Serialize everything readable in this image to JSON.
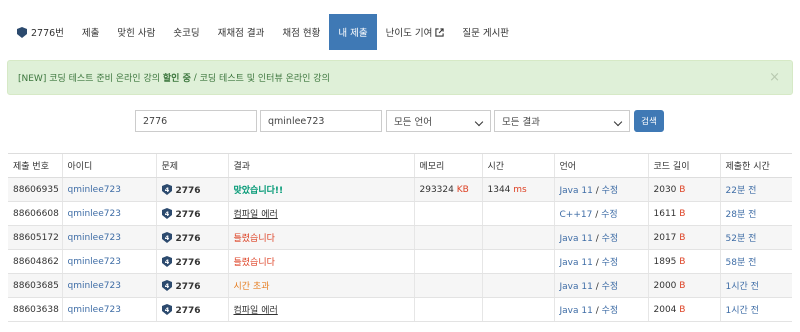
{
  "nav": {
    "items": [
      {
        "label": "2776번",
        "active": false
      },
      {
        "label": "제출",
        "active": false
      },
      {
        "label": "맞힌 사람",
        "active": false
      },
      {
        "label": "숏코딩",
        "active": false
      },
      {
        "label": "재채점 결과",
        "active": false
      },
      {
        "label": "채점 현황",
        "active": false
      },
      {
        "label": "내 제출",
        "active": true
      },
      {
        "label": "난이도 기여",
        "active": false
      },
      {
        "label": "질문 게시판",
        "active": false
      }
    ]
  },
  "alert": {
    "prefix": "[NEW] 코딩 테스트 준비 온라인 강의 ",
    "highlight": "할인 중",
    "separator": " / ",
    "suffix": "코딩 테스트 및 인터뷰 온라인 강의",
    "close": "×"
  },
  "filters": {
    "problem_id": "2776",
    "user_id": "qminlee723",
    "language": "모든 언어",
    "result": "모든 결과",
    "search_label": "검색"
  },
  "colors": {
    "accent": "#3f79b5",
    "accepted": "#009874",
    "wrong": "#dd4124",
    "timeout": "#e67e22",
    "tier": "#2c4a6e"
  },
  "table": {
    "headers": [
      "제출 번호",
      "아이디",
      "문제",
      "결과",
      "메모리",
      "시간",
      "언어",
      "코드 길이",
      "제출한 시간"
    ],
    "rows": [
      {
        "id": "88606935",
        "user": "qminlee723",
        "problem": "2776",
        "result": "맞았습니다!!",
        "result_type": "green",
        "memory": "293324",
        "memory_unit": "KB",
        "time": "1344",
        "time_unit": "ms",
        "lang": "Java 11",
        "edit": "수정",
        "len": "2030",
        "len_unit": "B",
        "submitted": "22분 전"
      },
      {
        "id": "88606608",
        "user": "qminlee723",
        "problem": "2776",
        "result": "컴파일 에러",
        "result_type": "ul",
        "memory": "",
        "memory_unit": "",
        "time": "",
        "time_unit": "",
        "lang": "C++17",
        "edit": "수정",
        "len": "1611",
        "len_unit": "B",
        "submitted": "28분 전"
      },
      {
        "id": "88605172",
        "user": "qminlee723",
        "problem": "2776",
        "result": "틀렸습니다",
        "result_type": "red",
        "memory": "",
        "memory_unit": "",
        "time": "",
        "time_unit": "",
        "lang": "Java 11",
        "edit": "수정",
        "len": "2017",
        "len_unit": "B",
        "submitted": "52분 전"
      },
      {
        "id": "88604862",
        "user": "qminlee723",
        "problem": "2776",
        "result": "틀렸습니다",
        "result_type": "red",
        "memory": "",
        "memory_unit": "",
        "time": "",
        "time_unit": "",
        "lang": "Java 11",
        "edit": "수정",
        "len": "1895",
        "len_unit": "B",
        "submitted": "58분 전"
      },
      {
        "id": "88603685",
        "user": "qminlee723",
        "problem": "2776",
        "result": "시간 초과",
        "result_type": "orange",
        "memory": "",
        "memory_unit": "",
        "time": "",
        "time_unit": "",
        "lang": "Java 11",
        "edit": "수정",
        "len": "2000",
        "len_unit": "B",
        "submitted": "1시간 전"
      },
      {
        "id": "88603638",
        "user": "qminlee723",
        "problem": "2776",
        "result": "컴파일 에러",
        "result_type": "ul",
        "memory": "",
        "memory_unit": "",
        "time": "",
        "time_unit": "",
        "lang": "Java 11",
        "edit": "수정",
        "len": "2004",
        "len_unit": "B",
        "submitted": "1시간 전"
      }
    ]
  }
}
